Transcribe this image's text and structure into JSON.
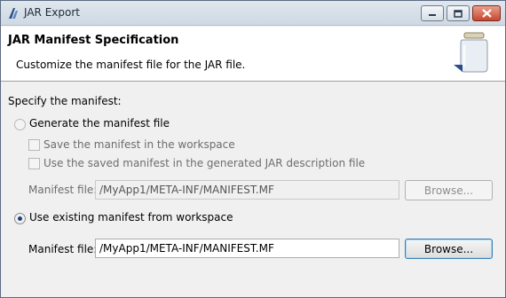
{
  "window": {
    "title": "JAR Export"
  },
  "header": {
    "title": "JAR Manifest Specification",
    "description": "Customize the manifest file for the JAR file."
  },
  "section_label": "Specify the manifest:",
  "generate_option": {
    "label": "Generate the manifest file",
    "selected": false,
    "save_in_workspace_label": "Save the manifest in the workspace",
    "use_saved_label": "Use the saved manifest in the generated JAR description file",
    "manifest_file_label": "Manifest file:",
    "manifest_file_value": "/MyApp1/META-INF/MANIFEST.MF",
    "browse_label": "Browse..."
  },
  "existing_option": {
    "label": "Use existing manifest from workspace",
    "selected": true,
    "manifest_file_label": "Manifest file:",
    "manifest_file_value": "/MyApp1/META-INF/MANIFEST.MF",
    "browse_label": "Browse..."
  },
  "icons": {
    "app": "eclipse-icon",
    "jar": "jar-icon",
    "minimize": "minimize-icon",
    "maximize": "maximize-icon",
    "close": "close-icon"
  }
}
